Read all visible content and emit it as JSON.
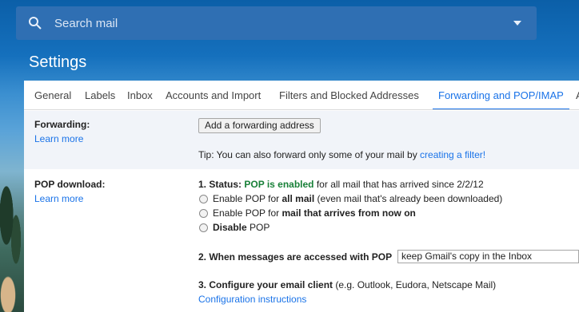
{
  "search": {
    "placeholder": "Search mail"
  },
  "page": {
    "title": "Settings"
  },
  "tabs": [
    {
      "label": "General"
    },
    {
      "label": "Labels"
    },
    {
      "label": "Inbox"
    },
    {
      "label": "Accounts and Import"
    },
    {
      "label": "Filters and Blocked Addresses"
    },
    {
      "label": "Forwarding and POP/IMAP"
    },
    {
      "label": "A"
    }
  ],
  "forwarding": {
    "label": "Forwarding:",
    "learn_more": "Learn more",
    "add_button": "Add a forwarding address",
    "tip_text": "Tip: You can also forward only some of your mail by ",
    "tip_link": "creating a filter!"
  },
  "pop": {
    "label": "POP download:",
    "learn_more": "Learn more",
    "status_prefix": "1. Status: ",
    "status_value": "POP is enabled",
    "status_suffix": " for all mail that has arrived since 2/2/12",
    "options": [
      {
        "pre": "Enable POP for ",
        "bold": "all mail",
        "post": " (even mail that's already been downloaded)"
      },
      {
        "pre": "Enable POP for ",
        "bold": "mail that arrives from now on",
        "post": ""
      },
      {
        "pre": "",
        "bold": "Disable",
        "post": " POP"
      }
    ],
    "when_accessed_label": "2. When messages are accessed with POP",
    "when_accessed_value": "keep Gmail's copy in the Inbox",
    "configure_label": "3. Configure your email client",
    "configure_hint": " (e.g. Outlook, Eudora, Netscape Mail)",
    "configure_link": "Configuration instructions"
  },
  "colors": {
    "accent": "#1a73e8",
    "status_green": "#188038",
    "search_bg": "#2f6fb3"
  }
}
